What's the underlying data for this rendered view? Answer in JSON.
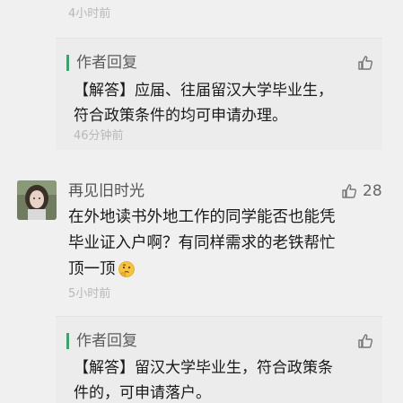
{
  "top_time": "4小时前",
  "reply1": {
    "label": "作者回复",
    "line1": "【解答】应届、往届留汉大学毕业生，",
    "line2": "符合政策条件的均可申请办理。",
    "time": "46分钟前"
  },
  "comment": {
    "name": "再见旧时光",
    "likes": "28",
    "line1": "在外地读书外地工作的同学能否也能凭",
    "line2": "毕业证入户啊？有同样需求的老铁帮忙",
    "line3": "顶一顶",
    "emoji": "thinking-face-icon",
    "time": "5小时前"
  },
  "reply2": {
    "label": "作者回复",
    "line1": "【解答】留汉大学毕业生，符合政策条",
    "line2": "件的，可申请落户。"
  },
  "colors": {
    "accent_green": "#2aae67",
    "background": "#f0f0f0",
    "reply_background": "#ececec"
  }
}
